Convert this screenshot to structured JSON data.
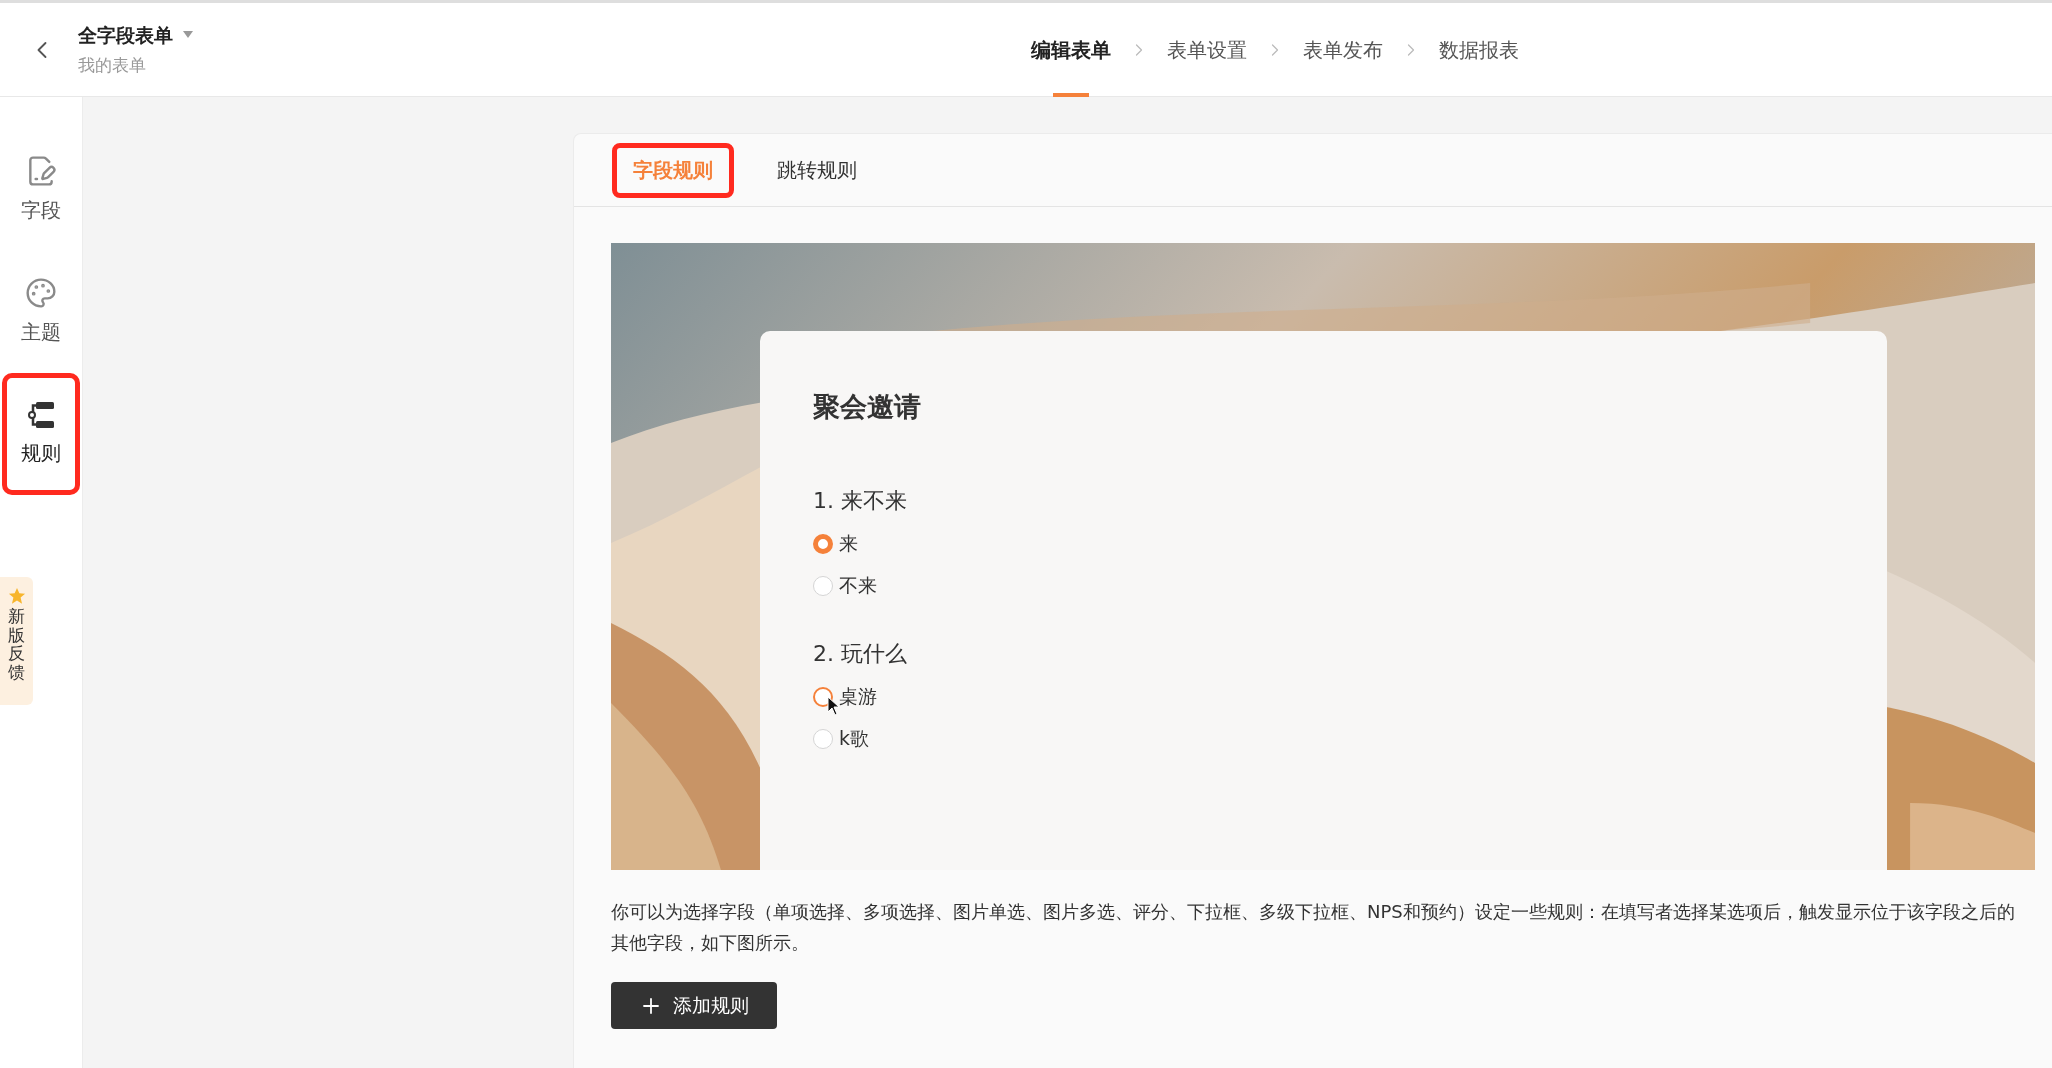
{
  "header": {
    "title": "全字段表单",
    "subtitle": "我的表单"
  },
  "steps": [
    {
      "label": "编辑表单",
      "selected": true
    },
    {
      "label": "表单设置",
      "selected": false
    },
    {
      "label": "表单发布",
      "selected": false
    },
    {
      "label": "数据报表",
      "selected": false
    }
  ],
  "sidebar": {
    "items": [
      {
        "label": "字段",
        "kind": "fields",
        "selected": false
      },
      {
        "label": "主题",
        "kind": "theme",
        "selected": false
      },
      {
        "label": "规则",
        "kind": "rules",
        "selected": true
      }
    ]
  },
  "feedback_tab": {
    "label": "新版反馈"
  },
  "tabs": [
    {
      "label": "字段规则",
      "selected": true
    },
    {
      "label": "跳转规则",
      "selected": false
    }
  ],
  "preview": {
    "title": "聚会邀请",
    "questions": [
      {
        "title": "1. 来不来",
        "options": [
          {
            "label": "来",
            "selected": true,
            "hovered": false
          },
          {
            "label": "不来",
            "selected": false,
            "hovered": false
          }
        ]
      },
      {
        "title": "2. 玩什么",
        "options": [
          {
            "label": "桌游",
            "selected": false,
            "hovered": true
          },
          {
            "label": "k歌",
            "selected": false,
            "hovered": false
          }
        ]
      }
    ]
  },
  "description": "你可以为选择字段（单项选择、多项选择、图片单选、图片多选、评分、下拉框、多级下拉框、NPS和预约）设定一些规则：在填写者选择某选项后，触发显示位于该字段之后的其他字段，如下图所示。",
  "add_button": {
    "label": "添加规则"
  }
}
